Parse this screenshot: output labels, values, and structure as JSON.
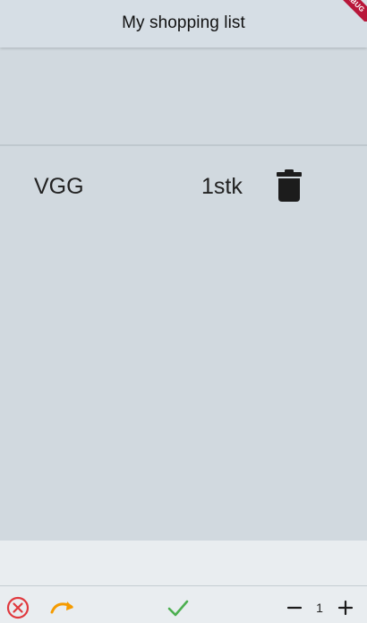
{
  "app": {
    "title": "My shopping list",
    "debug_banner": "DEBUG"
  },
  "list": {
    "items": [
      {
        "name": "VGG",
        "quantity": "1stk"
      }
    ]
  },
  "bottom_bar": {
    "count": "1",
    "icons": {
      "cancel": "cancel-circle-icon",
      "redo": "redo-arrow-icon",
      "confirm": "checkmark-icon",
      "decrement": "minus-icon",
      "increment": "plus-icon"
    }
  },
  "colors": {
    "background": "#d1d9df",
    "app_bar": "#d6dee5",
    "bottom_bar": "#e9edf0",
    "cancel": "#e0393e",
    "redo": "#f59b00",
    "confirm": "#4caf50",
    "debug_banner": "#b8173a"
  }
}
